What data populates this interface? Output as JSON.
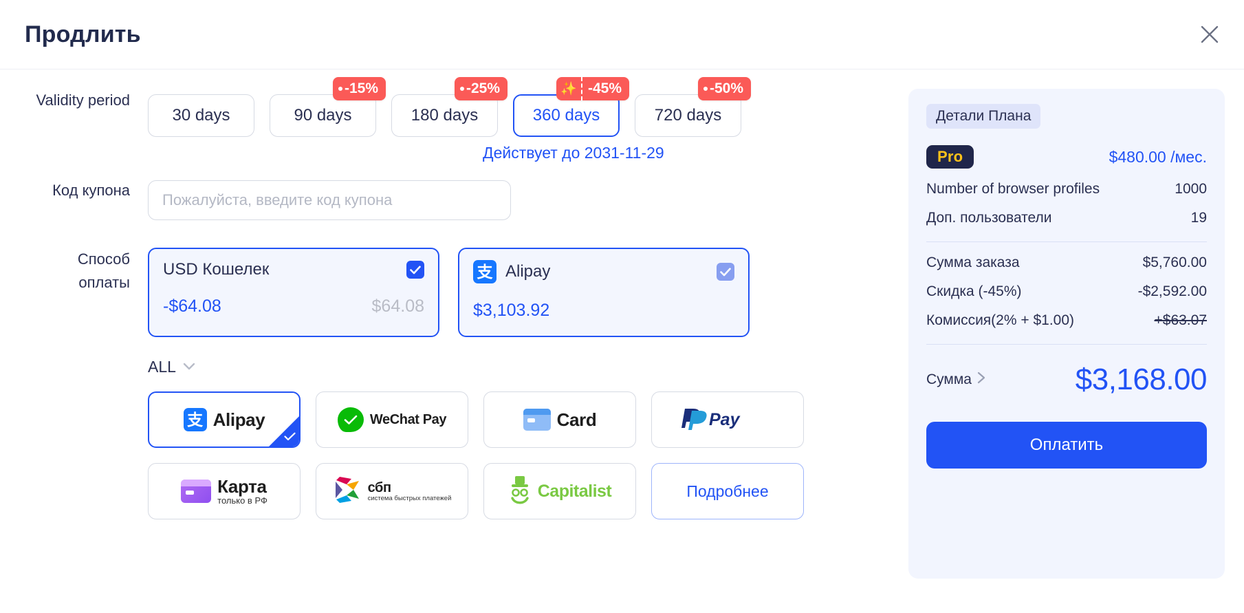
{
  "header": {
    "title": "Продлить",
    "close_icon": "close-icon"
  },
  "form": {
    "validity_label": "Validity period",
    "coupon_label": "Код купона",
    "payment_label_line1": "Способ",
    "payment_label_line2": "оплаты",
    "periods": [
      {
        "label": "30 days",
        "badge": null,
        "selected": false,
        "sparkle": false
      },
      {
        "label": "90 days",
        "badge": "-15%",
        "selected": false,
        "sparkle": false
      },
      {
        "label": "180 days",
        "badge": "-25%",
        "selected": false,
        "sparkle": false
      },
      {
        "label": "360 days",
        "badge": "-45%",
        "selected": true,
        "sparkle": true
      },
      {
        "label": "720 days",
        "badge": "-50%",
        "selected": false,
        "sparkle": false
      }
    ],
    "period_note": "Действует до 2031-11-29",
    "coupon_placeholder": "Пожалуйста, введите код купона",
    "coupon_value": "",
    "sources": [
      {
        "title": "USD Кошелек",
        "amount": "-$64.08",
        "balance": "$64.08",
        "checked": true,
        "icon": null
      },
      {
        "title": "Alipay",
        "amount": "$3,103.92",
        "balance": "",
        "checked": true,
        "icon": "alipay-icon"
      }
    ],
    "filter_label": "ALL",
    "filter_icon": "chevron-down-icon",
    "providers": [
      {
        "name": "Alipay",
        "selected": true
      },
      {
        "name": "WeChat Pay",
        "selected": false
      },
      {
        "name": "Card",
        "selected": false
      },
      {
        "name": "PayPal",
        "selected": false
      },
      {
        "name": "Карта",
        "sub": "только в РФ",
        "selected": false
      },
      {
        "name": "сбп",
        "sub": "система быстрых платежей",
        "selected": false
      },
      {
        "name": "Capitalist",
        "selected": false
      },
      {
        "name": "Подробнее",
        "selected": false,
        "is_more": true
      }
    ]
  },
  "summary": {
    "chip": "Детали Плана",
    "plan_badge": "Pro",
    "plan_price": "$480.00 /мес.",
    "features": [
      {
        "label": "Number of browser profiles",
        "value": "1000"
      },
      {
        "label": "Доп. пользователи",
        "value": "19"
      }
    ],
    "lines": [
      {
        "label": "Сумма заказа",
        "value": "$5,760.00",
        "strike": false
      },
      {
        "label": "Скидка (-45%)",
        "value": "-$2,592.00",
        "strike": false
      },
      {
        "label": "Комиссия(2% + $1.00)",
        "value": "+$63.07",
        "strike": true
      }
    ],
    "total_label": "Сумма",
    "total_icon": "chevron-right-icon",
    "total_value": "$3,168.00",
    "pay_button": "Оплатить"
  },
  "colors": {
    "accent": "#2253f5",
    "badge_red": "#fb5a57",
    "panel_bg": "#f2f5fe",
    "pro_bg": "#20264a",
    "pro_fg": "#ffc21a"
  }
}
